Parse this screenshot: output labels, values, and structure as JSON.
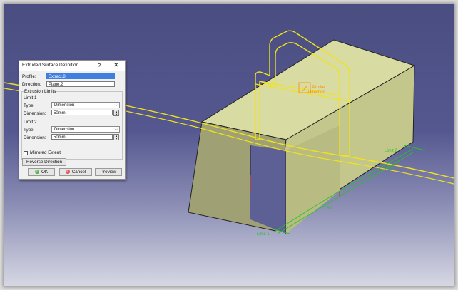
{
  "dialog": {
    "title": "Extruded Surface Definition",
    "help_label": "?",
    "close_label": "✕",
    "profile_label": "Profile:",
    "profile_value": "Extract.8",
    "direction_label": "Direction:",
    "direction_value": "Plane.2",
    "extrusion_limits_label": "Extrusion Limits",
    "limit1": {
      "label": "Limit 1",
      "type_label": "Type:",
      "type_value": "Dimension",
      "dimension_label": "Dimension:",
      "dimension_value": "50mm"
    },
    "limit2": {
      "label": "Limit 2",
      "type_label": "Type:",
      "type_value": "Dimension",
      "dimension_label": "Dimension:",
      "dimension_value": "50mm"
    },
    "mirrored_label": "Mirrored Extent",
    "mirrored_checked": false,
    "reverse_label": "Reverse Direction",
    "ok_label": "OK",
    "cancel_label": "Cancel",
    "preview_label": "Preview"
  },
  "viewport": {
    "profile_label_line1": "Profile",
    "profile_label_line2": "Direction",
    "limit_label_top": "Limit 2",
    "limit_label_bottom": "Limit 1",
    "dim_label_top": "50",
    "dim_label_bottom": "50",
    "face_color": "#c8cb8e",
    "top_face_color": "#d8dca2",
    "curve_color": "#f2e21c",
    "dimension_color": "#27c425",
    "label_color": "#ff8a00"
  }
}
